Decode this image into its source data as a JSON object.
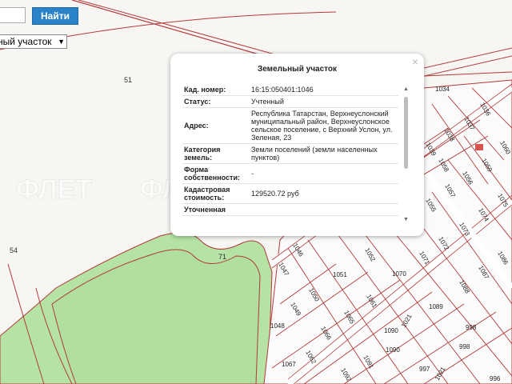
{
  "toolbar": {
    "search_value": "",
    "search_button": "Найти",
    "type_select": "ный участок",
    "select_arrow": "▼"
  },
  "map": {
    "labels": [
      "51",
      "54",
      "71"
    ],
    "watermark": "ФЛЕТ",
    "parcels": [
      "1034",
      "1036",
      "1037",
      "1038",
      "1039",
      "1059",
      "1060",
      "1056",
      "1057",
      "1055",
      "1058",
      "1074",
      "1075",
      "1073",
      "1072",
      "1071",
      "1070",
      "1052",
      "1051",
      "1050",
      "1049",
      "1048",
      "1047",
      "1046",
      "1069",
      "1068",
      "1067",
      "1066",
      "1065",
      "1064",
      "1063",
      "1062",
      "1061",
      "1090",
      "1091",
      "1092",
      "1089",
      "1088",
      "1087",
      "1086",
      "998",
      "997",
      "1021",
      "1025",
      "996"
    ]
  },
  "popup": {
    "title": "Земельный участок",
    "close": "×",
    "scroll_up": "▲",
    "scroll_down": "▼",
    "rows": [
      {
        "key": "Кад. номер:",
        "value": "16:15:050401:1046"
      },
      {
        "key": "Статус:",
        "value": "Учтенный"
      },
      {
        "key": "Адрес:",
        "value": "Республика Татарстан, Верхнеуслонский муниципальный район, Верхнеуслонское сельское поселение, с Верхний Услон, ул. Зеленая, 23"
      },
      {
        "key": "Категория земель:",
        "value": "Земли поселений (земли населенных пунктов)"
      },
      {
        "key": "Форма собственности:",
        "value": "-"
      },
      {
        "key": "Кадастровая стоимость:",
        "value": "129520.72 руб"
      },
      {
        "key": "Уточненная",
        "value": ""
      }
    ]
  },
  "colors": {
    "parcel_border": "#b33a3a",
    "road": "#ffffff",
    "forest": "#b5e3a4",
    "button": "#2a82c9"
  }
}
